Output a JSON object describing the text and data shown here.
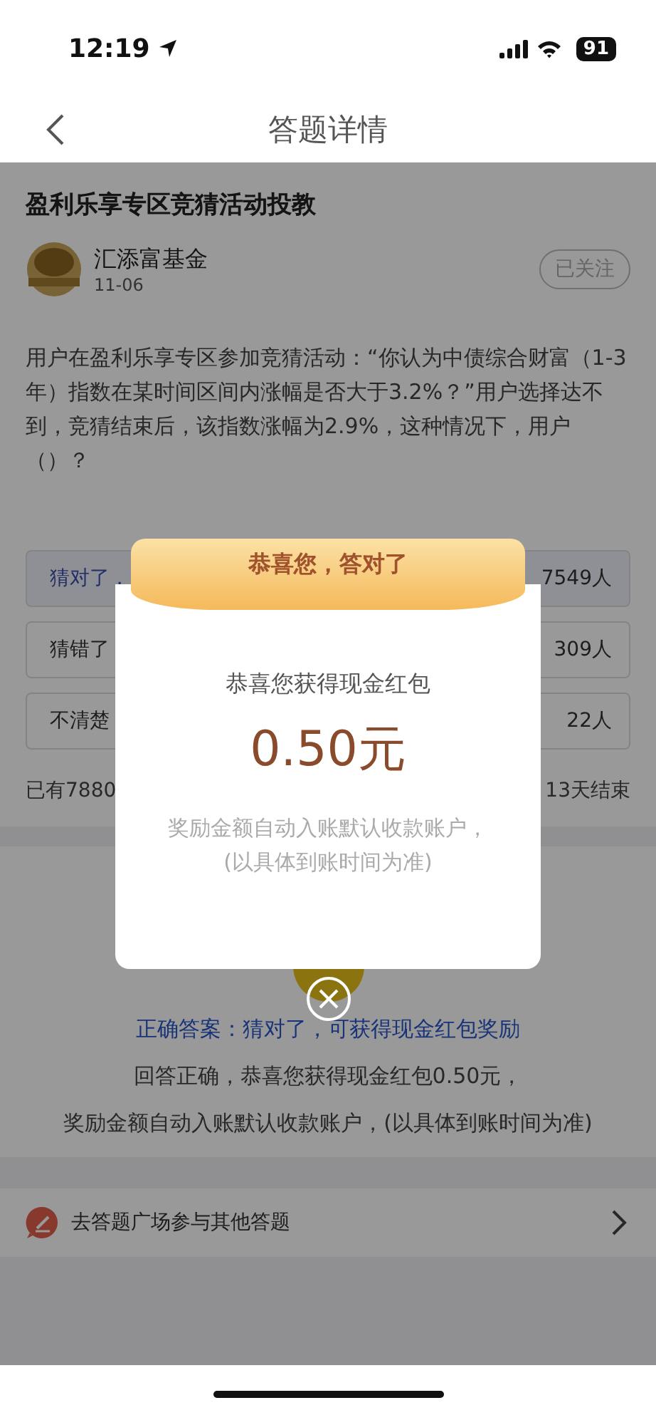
{
  "status_bar": {
    "time": "12:19",
    "battery": "91"
  },
  "nav": {
    "title": "答题详情"
  },
  "article": {
    "title": "盈利乐享专区竞猜活动投教",
    "author": "汇添富基金",
    "date": "11-06",
    "follow": "已关注",
    "question": "用户在盈利乐享专区参加竞猜活动：“你认为中债综合财富（1-3年）指数在某时间区间内涨幅是否大于3.2%？”用户选择达不到，竞猜结束后，该指数涨幅为2.9%，这种情况下，用户（）？"
  },
  "options": [
    {
      "label": "猜对了，",
      "count": "7549人",
      "selected": true
    },
    {
      "label": "猜错了",
      "count": "309人",
      "selected": false
    },
    {
      "label": "不清楚",
      "count": "22人",
      "selected": false
    }
  ],
  "summary": {
    "left": "已有7880",
    "right": "13天结束"
  },
  "answer": {
    "correct": "正确答案：猜对了，可获得现金红包奖励",
    "line_1": "回答正确，恭喜您获得现金红包0.50元，",
    "line_2": "奖励金额自动入账默认收款账户，(以具体到账时间为准)"
  },
  "link": {
    "label": "去答题广场参与其他答题"
  },
  "modal": {
    "ribbon": "恭喜您，答对了",
    "subtitle": "恭喜您获得现金红包",
    "amount": "0.50元",
    "note_1": "奖励金额自动入账默认收款账户，",
    "note_2": "(以具体到账时间为准)"
  }
}
